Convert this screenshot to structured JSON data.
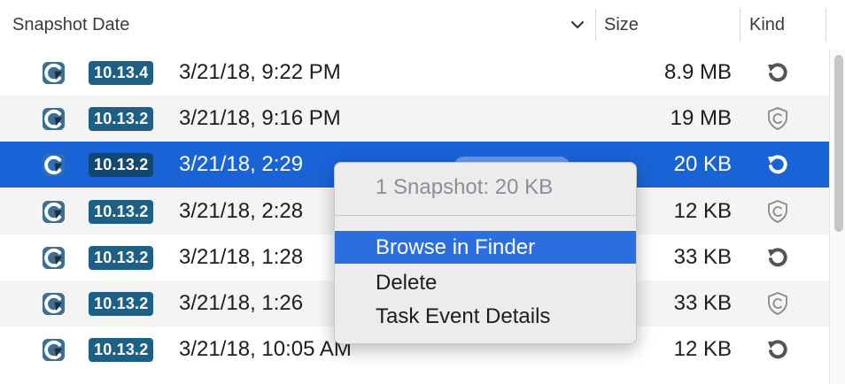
{
  "header": {
    "snapshot_date": "Snapshot Date",
    "size": "Size",
    "kind": "Kind",
    "sort_icon": "chevron-down-icon"
  },
  "rows": [
    {
      "version": "10.13.4",
      "date": "3/21/18, 9:22 PM",
      "size": "8.9 MB",
      "kind": "restore-icon",
      "selected": false
    },
    {
      "version": "10.13.2",
      "date": "3/21/18, 9:16 PM",
      "size": "19 MB",
      "kind": "shield-icon",
      "selected": false
    },
    {
      "version": "10.13.2",
      "date": "3/21/18, 2:29",
      "size": "20 KB",
      "kind": "restore-icon",
      "selected": true
    },
    {
      "version": "10.13.2",
      "date": "3/21/18, 2:28",
      "size": "12 KB",
      "kind": "shield-icon",
      "selected": false
    },
    {
      "version": "10.13.2",
      "date": "3/21/18, 1:28",
      "size": "33 KB",
      "kind": "restore-icon",
      "selected": false
    },
    {
      "version": "10.13.2",
      "date": "3/21/18, 1:26",
      "size": "33 KB",
      "kind": "shield-icon",
      "selected": false
    },
    {
      "version": "10.13.2",
      "date": "3/21/18, 10:05 AM",
      "size": "12 KB",
      "kind": "restore-icon",
      "selected": false
    }
  ],
  "context_menu": {
    "header": "1 Snapshot: 20 KB",
    "items": [
      "Browse in Finder",
      "Delete",
      "Task Event Details"
    ],
    "highlighted": "Browse in Finder"
  },
  "colors": {
    "selection": "#1a63d6",
    "badge": "#1e5f86",
    "menu_highlight": "#2a6ee0"
  }
}
